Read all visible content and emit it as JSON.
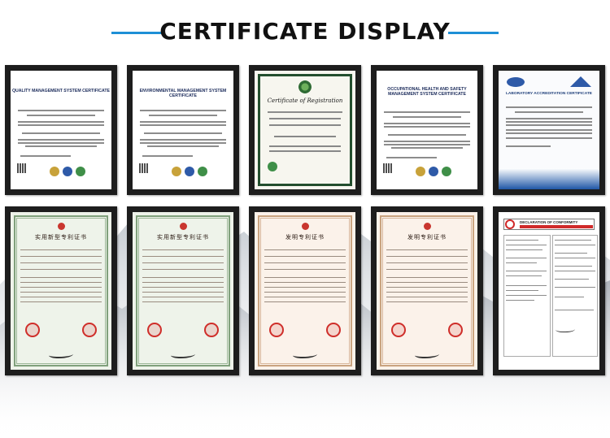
{
  "page": {
    "title": "CERTIFICATE DISPLAY",
    "accent_color": "#1e8fd6",
    "background_color": "#ffffff"
  },
  "certificates_row1": [
    {
      "kind": "quality-management-system-certificate",
      "theme": "#1a2a5a",
      "heading": "QUALITY MANAGEMENT SYSTEM CERTIFICATE"
    },
    {
      "kind": "environmental-management-system-certificate",
      "theme": "#1a2a5a",
      "heading": "ENVIRONMENTAL MANAGEMENT SYSTEM CERTIFICATE"
    },
    {
      "kind": "certificate-of-registration",
      "theme": "#234e2e",
      "heading": "Certificate of Registration"
    },
    {
      "kind": "occupational-health-safety-certificate",
      "theme": "#1a2a5a",
      "heading": "OCCUPATIONAL HEALTH AND SAFETY MANAGEMENT SYSTEM CERTIFICATE"
    },
    {
      "kind": "laboratory-accreditation-certificate",
      "theme": "#1f56a6",
      "heading": "LABORATORY ACCREDITATION CERTIFICATE"
    }
  ],
  "certificates_row2": [
    {
      "kind": "utility-model-patent-certificate",
      "theme": "#7fa07b",
      "heading": "实用新型专利证书"
    },
    {
      "kind": "utility-model-patent-certificate",
      "theme": "#7fa07b",
      "heading": "实用新型专利证书"
    },
    {
      "kind": "invention-patent-certificate",
      "theme": "#c9a37f",
      "heading": "发明专利证书"
    },
    {
      "kind": "invention-patent-certificate",
      "theme": "#c9a37f",
      "heading": "发明专利证书"
    },
    {
      "kind": "declaration-of-conformity",
      "theme": "#d02a2a",
      "heading": "DECLARATION OF CONFORMITY"
    }
  ]
}
